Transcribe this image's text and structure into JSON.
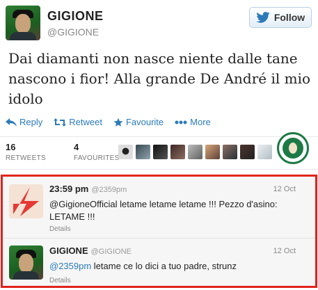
{
  "tweet": {
    "name": "GIGIONE",
    "handle": "@GIGIONE",
    "follow_label": "Follow",
    "text": "Dai diamanti non nasce niente dalle tane nascono i fior! Alla grande De André il mio idolo",
    "actions": {
      "reply": "Reply",
      "retweet": "Retweet",
      "favourite": "Favourite",
      "more": "More"
    },
    "stats": {
      "retweets_count": "16",
      "retweets_label": "RETWEETS",
      "favourites_count": "4",
      "favourites_label": "FAVOURITES"
    }
  },
  "replies": [
    {
      "time": "23:59 pm",
      "handle": "@2359pm",
      "date": "12 Oct",
      "text": "@GigioneOfficial letame letame letame !!! Pezzo d'asino: LETAME !!!",
      "details": "Details"
    },
    {
      "name": "GIGIONE",
      "handle": "@GIGIONE",
      "date": "12 Oct",
      "mention": "@2359pm",
      "text": " letame ce lo dici a tuo padre, strunz",
      "details": "Details"
    }
  ],
  "colors": {
    "link": "#2b7bb9",
    "highlight_border": "#e1241b",
    "twitter_blue": "#2b7bb9"
  }
}
